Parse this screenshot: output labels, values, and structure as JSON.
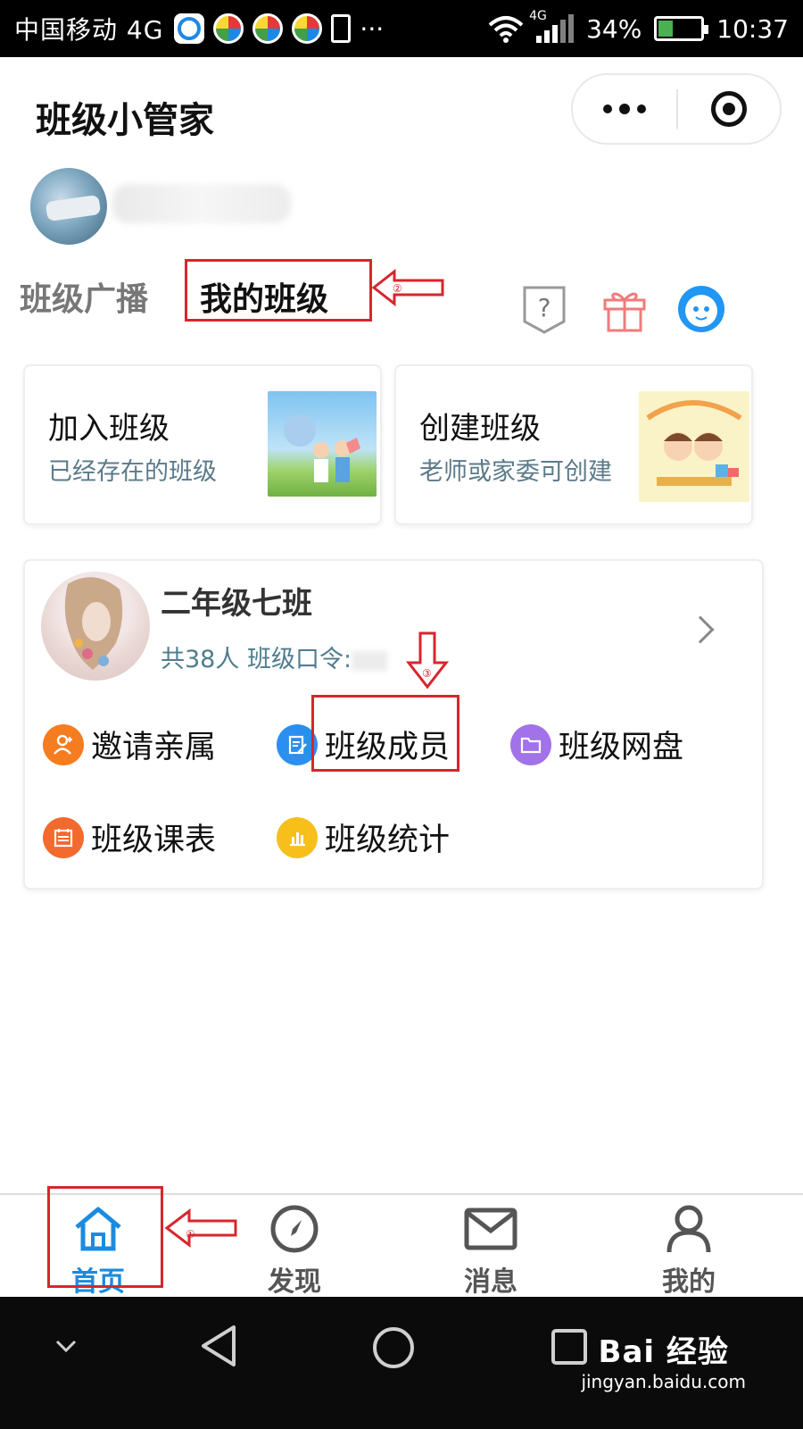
{
  "status_bar": {
    "carrier": "中国移动 4G",
    "network_tag": "4G",
    "battery": "34%",
    "battery_level": 0.34,
    "time": "10:37",
    "more": "···"
  },
  "header": {
    "app_title": "班级小管家"
  },
  "tabs": {
    "broadcast": "班级广播",
    "my_class": "我的班级"
  },
  "annotations": {
    "step1": "①",
    "step2": "②",
    "step3": "③",
    "color": "#d8262d"
  },
  "cards": {
    "join": {
      "title": "加入班级",
      "subtitle": "已经存在的班级"
    },
    "create": {
      "title": "创建班级",
      "subtitle": "老师或家委可创建"
    }
  },
  "class_card": {
    "name": "二年级七班",
    "info": "共38人 班级口令:",
    "actions": [
      {
        "label": "邀请亲属",
        "icon": "invite-user-icon",
        "color": "#f57c1f"
      },
      {
        "label": "班级成员",
        "icon": "members-edit-icon",
        "color": "#2b8ff0"
      },
      {
        "label": "班级网盘",
        "icon": "folder-icon",
        "color": "#a272e8"
      },
      {
        "label": "班级课表",
        "icon": "schedule-icon",
        "color": "#f26a2e"
      },
      {
        "label": "班级统计",
        "icon": "bar-chart-icon",
        "color": "#f6bf1a"
      }
    ]
  },
  "bottom_nav": {
    "items": [
      {
        "label": "首页",
        "icon": "home-icon",
        "active": true
      },
      {
        "label": "发现",
        "icon": "compass-icon",
        "active": false
      },
      {
        "label": "消息",
        "icon": "mail-icon",
        "active": false
      },
      {
        "label": "我的",
        "icon": "user-icon",
        "active": false
      }
    ]
  },
  "watermark": {
    "main": "Bai 经验",
    "sub": "jingyan.baidu.com"
  },
  "colors": {
    "accent_blue": "#1a8be0",
    "annotation_red": "#d8262d",
    "subtitle": "#5b7a8a"
  }
}
